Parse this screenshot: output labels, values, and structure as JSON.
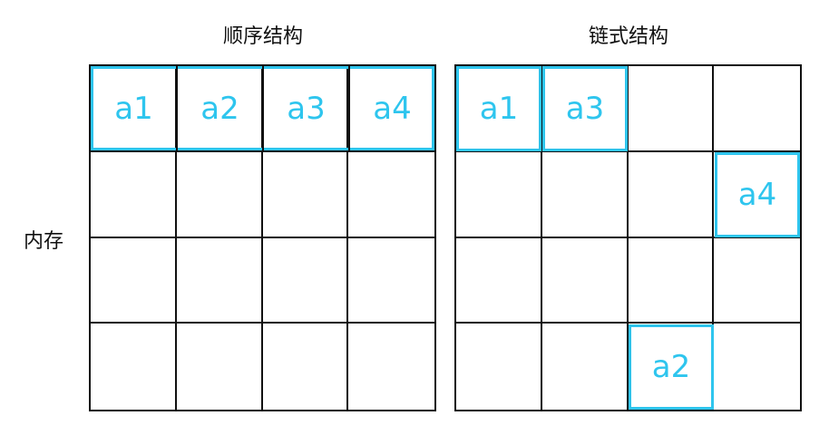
{
  "titles": {
    "sequential": "顺序结构",
    "linked": "链式结构"
  },
  "memory_label": "内存",
  "sequential": {
    "elements": [
      "a1",
      "a2",
      "a3",
      "a4"
    ]
  },
  "linked": {
    "elements": [
      {
        "label": "a1",
        "row": 0,
        "col": 0
      },
      {
        "label": "a3",
        "row": 0,
        "col": 1
      },
      {
        "label": "a4",
        "row": 1,
        "col": 3
      },
      {
        "label": "a2",
        "row": 3,
        "col": 2
      }
    ]
  },
  "colors": {
    "accent": "#2ec5ee",
    "grid_line": "#111111"
  }
}
